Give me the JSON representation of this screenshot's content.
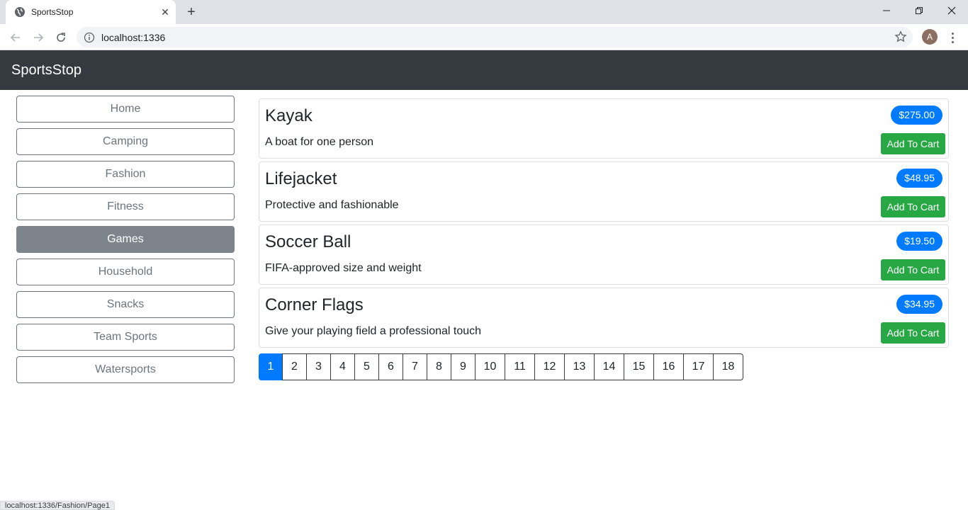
{
  "browser": {
    "tab_title": "SportsStop",
    "url": "localhost:1336",
    "profile_initial": "A",
    "status_url": "localhost:1336/Fashion/Page1"
  },
  "app": {
    "brand": "SportsStop"
  },
  "categories": [
    {
      "label": "Home",
      "active": false
    },
    {
      "label": "Camping",
      "active": false
    },
    {
      "label": "Fashion",
      "active": false
    },
    {
      "label": "Fitness",
      "active": false
    },
    {
      "label": "Games",
      "active": true
    },
    {
      "label": "Household",
      "active": false
    },
    {
      "label": "Snacks",
      "active": false
    },
    {
      "label": "Team Sports",
      "active": false
    },
    {
      "label": "Watersports",
      "active": false
    }
  ],
  "products": [
    {
      "name": "Kayak",
      "description": "A boat for one person",
      "price": "$275.00",
      "button": "Add To Cart"
    },
    {
      "name": "Lifejacket",
      "description": "Protective and fashionable",
      "price": "$48.95",
      "button": "Add To Cart"
    },
    {
      "name": "Soccer Ball",
      "description": "FIFA-approved size and weight",
      "price": "$19.50",
      "button": "Add To Cart"
    },
    {
      "name": "Corner Flags",
      "description": "Give your playing field a professional touch",
      "price": "$34.95",
      "button": "Add To Cart"
    }
  ],
  "pagination": {
    "pages": [
      "1",
      "2",
      "3",
      "4",
      "5",
      "6",
      "7",
      "8",
      "9",
      "10",
      "11",
      "12",
      "13",
      "14",
      "15",
      "16",
      "17",
      "18"
    ],
    "current": "1"
  },
  "colors": {
    "navbar": "#343a40",
    "primary": "#007bff",
    "success": "#28a745",
    "active_category": "#7d848b"
  }
}
